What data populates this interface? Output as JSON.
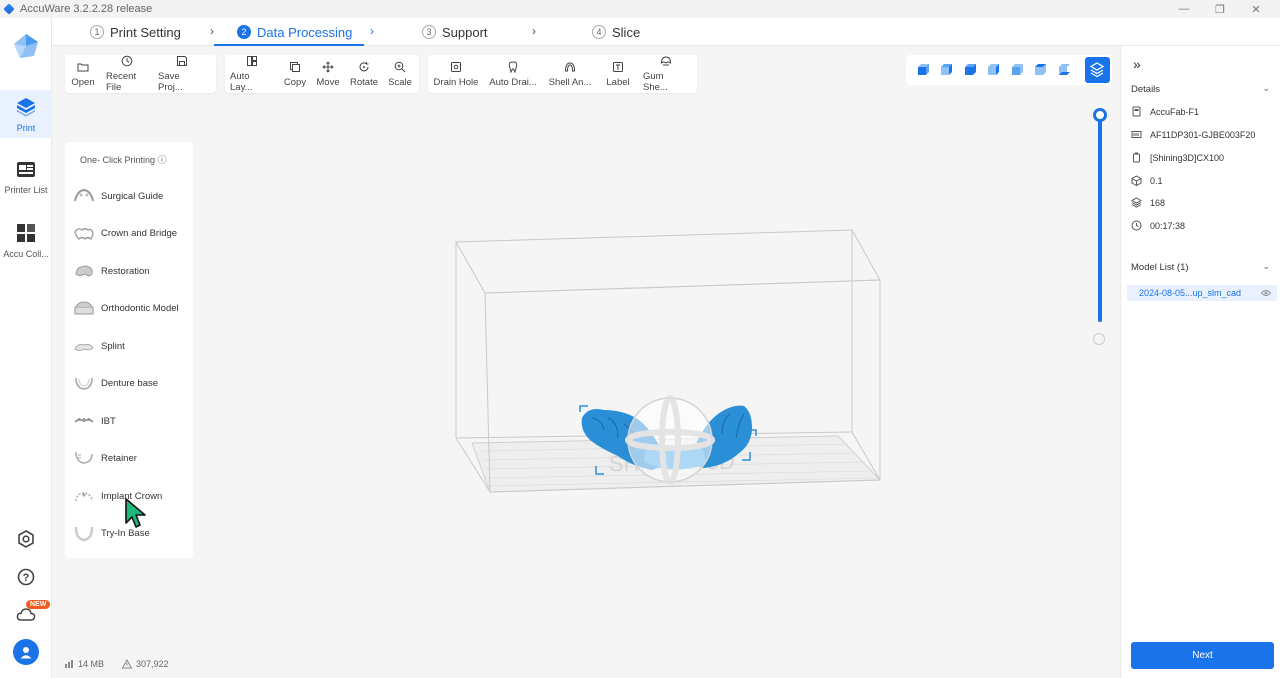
{
  "app": {
    "title": "AccuWare 3.2.2.28 release"
  },
  "window": {
    "min": "—",
    "restore": "❐",
    "close": "✕"
  },
  "rail": {
    "items": [
      {
        "label": "Print",
        "icon": "print-cube-icon",
        "active": true
      },
      {
        "label": "Printer List",
        "icon": "printer-list-icon"
      },
      {
        "label": "Accu Coll...",
        "icon": "accu-collection-icon"
      }
    ],
    "bottom": [
      {
        "icon": "settings-icon"
      },
      {
        "icon": "help-icon"
      },
      {
        "icon": "cloud-icon",
        "badge": "NEW"
      },
      {
        "icon": "user-avatar-icon"
      }
    ]
  },
  "steps": [
    {
      "num": "1",
      "label": "Print Setting"
    },
    {
      "num": "2",
      "label": "Data Processing",
      "active": true
    },
    {
      "num": "3",
      "label": "Support"
    },
    {
      "num": "4",
      "label": "Slice"
    }
  ],
  "toolbar": {
    "group1": [
      {
        "label": "Open",
        "icon": "folder-icon"
      },
      {
        "label": "Recent File",
        "icon": "clock-icon"
      },
      {
        "label": "Save Proj...",
        "icon": "save-icon"
      }
    ],
    "group2": [
      {
        "label": "Auto Lay...",
        "icon": "auto-layout-icon"
      },
      {
        "label": "Copy",
        "icon": "copy-icon"
      },
      {
        "label": "Move",
        "icon": "move-icon"
      },
      {
        "label": "Rotate",
        "icon": "rotate-icon"
      },
      {
        "label": "Scale",
        "icon": "scale-icon"
      }
    ],
    "group3": [
      {
        "label": "Drain Hole",
        "icon": "drain-hole-icon"
      },
      {
        "label": "Auto Drai...",
        "icon": "auto-drain-icon"
      },
      {
        "label": "Shell An...",
        "icon": "shell-icon"
      },
      {
        "label": "Label",
        "icon": "label-icon"
      },
      {
        "label": "Gum She...",
        "icon": "gum-shell-icon"
      }
    ]
  },
  "one_click": {
    "title": "One- Click Printing ⓘ",
    "items": [
      "Surgical Guide",
      "Crown and Bridge",
      "Restoration",
      "Orthodontic Model",
      "Splint",
      "Denture base",
      "IBT",
      "Retainer",
      "Implant Crown",
      "Try-In Base"
    ]
  },
  "details": {
    "title": "Details",
    "rows": [
      {
        "icon": "printer-icon",
        "value": "AccuFab-F1"
      },
      {
        "icon": "serial-icon",
        "value": "AF11DP301-GJBE003F20"
      },
      {
        "icon": "resin-icon",
        "value": "[Shining3D]CX100"
      },
      {
        "icon": "layer-thickness-icon",
        "value": "0.1"
      },
      {
        "icon": "layers-icon",
        "value": "168"
      },
      {
        "icon": "time-icon",
        "value": "00:17:38"
      }
    ]
  },
  "model_list": {
    "title": "Model List (1)",
    "items": [
      "2024-08-05...up_slm_cad"
    ]
  },
  "next_label": "Next",
  "status": {
    "memory": "14 MB",
    "triangles": "307,922"
  },
  "colors": {
    "accent": "#1a73e8",
    "model": "#2b8fd8"
  }
}
